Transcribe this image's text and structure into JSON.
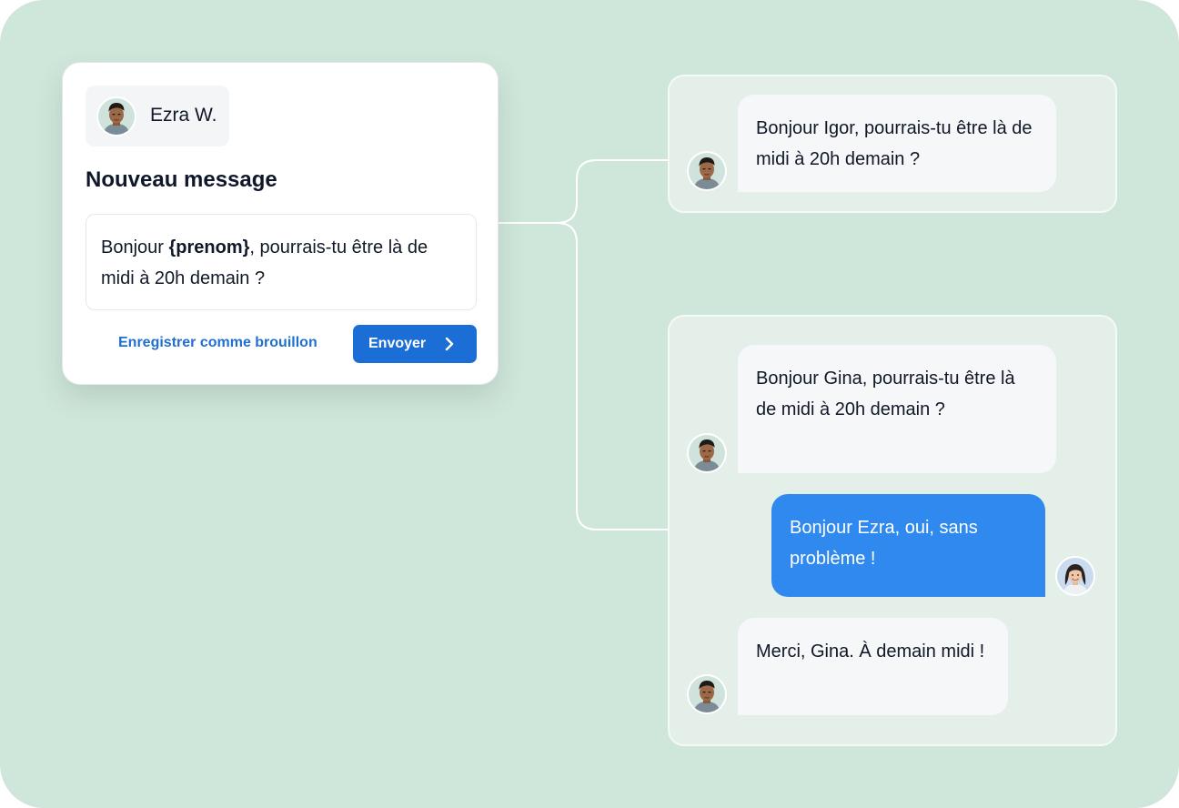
{
  "composer": {
    "sender": {
      "name": "Ezra W.",
      "avatar": "person-ezra-avatar"
    },
    "title": "Nouveau message",
    "message": {
      "before": "Bonjour ",
      "variable": "{prenom}",
      "after": ", pourrais-tu être là de midi à 20h demain ?"
    },
    "draft_label": "Enregistrer comme brouillon",
    "send_label": "Envoyer",
    "send_icon": "chevron-right-icon",
    "accent_color": "#1b6ed6"
  },
  "conversations": [
    {
      "messages": [
        {
          "direction": "incoming",
          "sender_avatar": "person-ezra-avatar",
          "text": "Bonjour Igor, pourrais-tu être là de midi à 20h demain ?"
        }
      ]
    },
    {
      "messages": [
        {
          "direction": "incoming",
          "sender_avatar": "person-ezra-avatar",
          "text": "Bonjour Gina, pourrais-tu être là de midi à 20h demain ?"
        },
        {
          "direction": "outgoing",
          "sender_avatar": "person-gina-avatar",
          "text": "Bonjour Ezra, oui, sans problème !"
        },
        {
          "direction": "incoming",
          "sender_avatar": "person-ezra-avatar",
          "text": "Merci, Gina. À demain midi !"
        }
      ]
    }
  ],
  "colors": {
    "background": "#cfe6da",
    "panel": "#e3efe8",
    "incoming_bubble": "#f5f7f9",
    "outgoing_bubble": "#2f89ee",
    "link": "#1f6fd1"
  }
}
